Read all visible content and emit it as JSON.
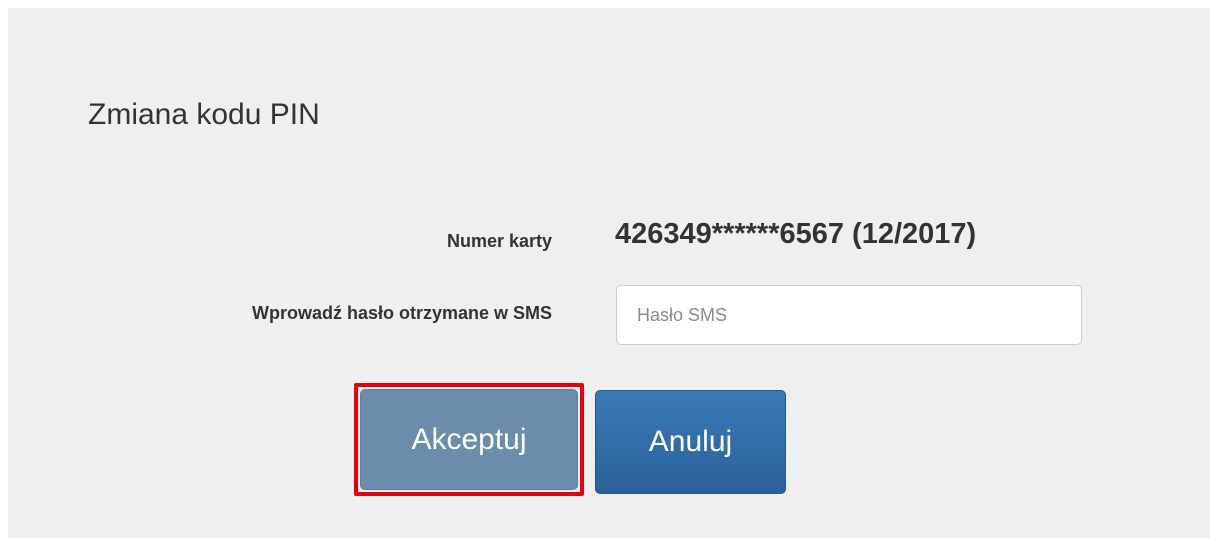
{
  "dialog": {
    "title": "Zmiana kodu PIN"
  },
  "form": {
    "card_label": "Numer karty",
    "card_value": "426349******6567 (12/2017)",
    "sms_label": "Wprowadź hasło otrzymane w SMS",
    "sms_placeholder": "Hasło SMS",
    "sms_value": ""
  },
  "buttons": {
    "accept_label": "Akceptuj",
    "cancel_label": "Anuluj"
  },
  "colors": {
    "background": "#efefef",
    "accept_button": "#6c8cab",
    "cancel_button": "#2f6da9",
    "highlight_border": "#e8000b"
  }
}
